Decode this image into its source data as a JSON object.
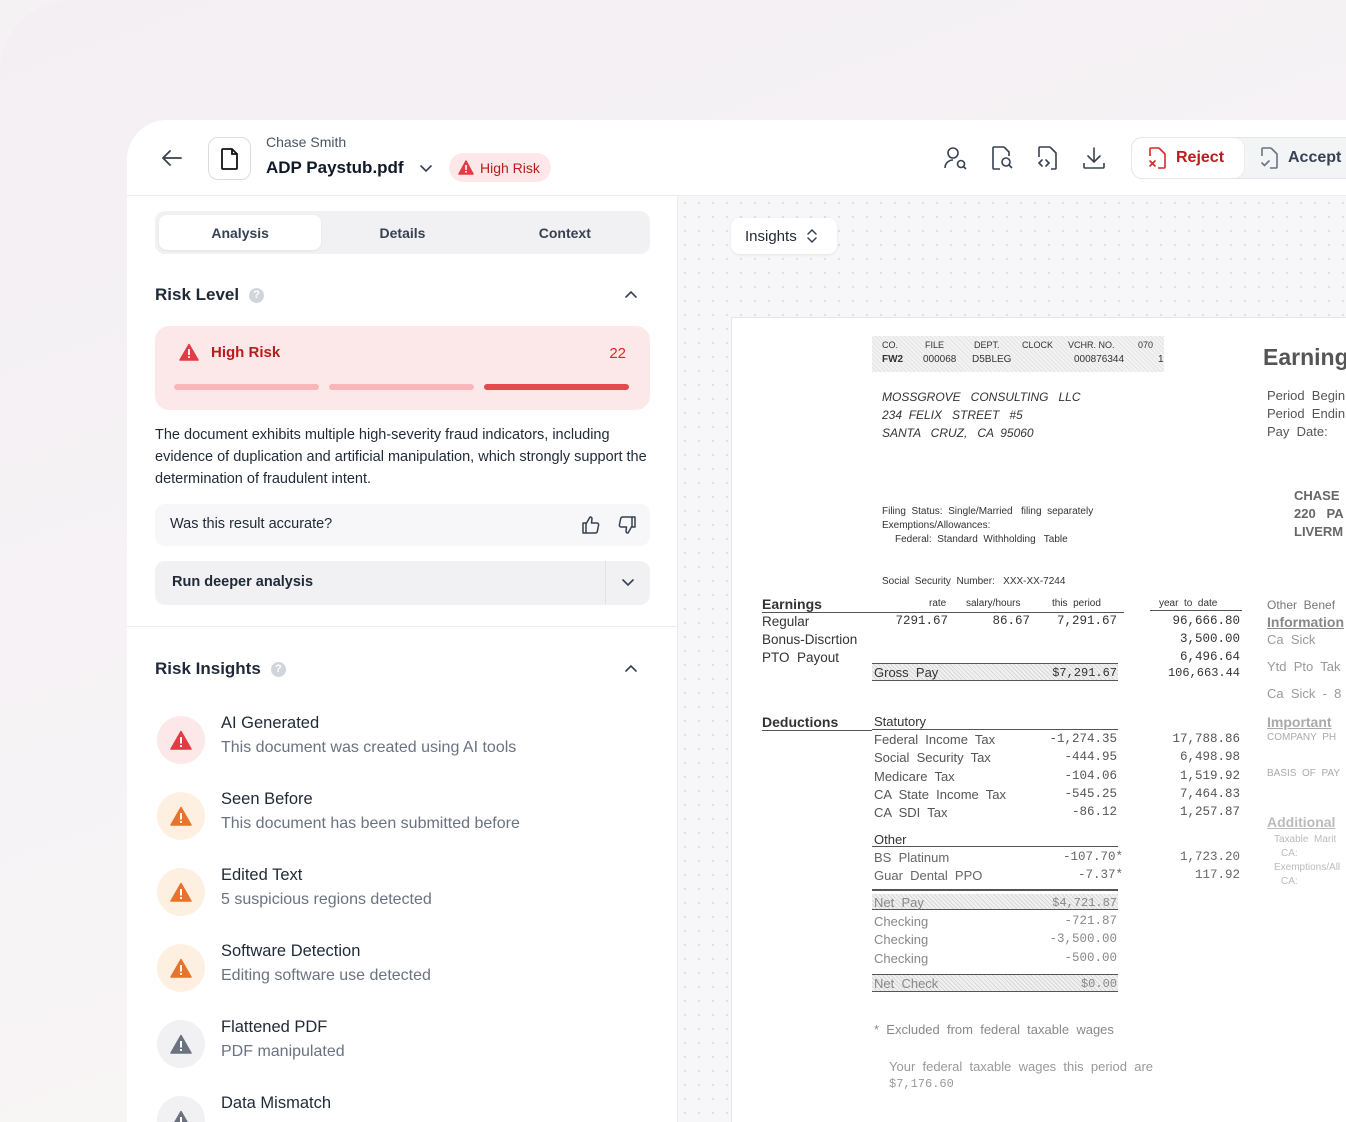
{
  "header": {
    "owner": "Chase Smith",
    "filename": "ADP Paystub.pdf",
    "risk_badge": "High Risk",
    "reject_label": "Reject",
    "accept_label": "Accept"
  },
  "tabs": [
    "Analysis",
    "Details",
    "Context"
  ],
  "risk_level": {
    "heading": "Risk Level",
    "label": "High Risk",
    "score": "22",
    "description": "The document exhibits multiple high-severity fraud indicators, including evidence of duplication and artificial manipulation, which strongly support the determination of fraudulent intent.",
    "feedback_question": "Was this result accurate?",
    "deeper_label": "Run deeper analysis"
  },
  "risk_insights": {
    "heading": "Risk Insights",
    "items": [
      {
        "title": "AI Generated",
        "subtitle": "This document was created using AI tools",
        "severity": "high"
      },
      {
        "title": "Seen Before",
        "subtitle": "This document has been submitted before",
        "severity": "medium"
      },
      {
        "title": "Edited Text",
        "subtitle": "5 suspicious regions detected",
        "severity": "medium"
      },
      {
        "title": "Software Detection",
        "subtitle": "Editing software use detected",
        "severity": "medium"
      },
      {
        "title": "Flattened PDF",
        "subtitle": "PDF manipulated",
        "severity": "low"
      },
      {
        "title": "Data Mismatch",
        "subtitle": "",
        "severity": "low"
      }
    ]
  },
  "viewer": {
    "dropdown_label": "Insights"
  },
  "colors": {
    "high": "#e03c45",
    "high_bg": "#fde8e9",
    "medium": "#e8732c",
    "medium_bg": "#fdf0e1",
    "low": "#6b7280",
    "low_bg": "#f1f1f3"
  },
  "paystub": {
    "hdr_labels": [
      "CO.",
      "FILE",
      "DEPT.",
      "CLOCK",
      "VCHR. NO.",
      "070"
    ],
    "hdr_values": [
      "FW2",
      "000068",
      "D5BLEG",
      "000876344",
      "1"
    ],
    "company": [
      "MOSSGROVE   CONSULTING   LLC",
      "234  FELIX   STREET   #5",
      "SANTA   CRUZ,   CA  95060"
    ],
    "filing": [
      "Filing  Status:  Single/Married   filing  separately",
      "Exemptions/Allowances:",
      "Federal:  Standard  Withholding   Table"
    ],
    "ssn": "Social  Security  Number:   XXX-XX-7244",
    "earnings_title": "Earnings",
    "col_rate": "rate",
    "col_hours": "salary/hours",
    "col_period": "this  period",
    "col_ytd": "year  to  date",
    "earn_rows": [
      {
        "label": "Regular",
        "rate": "7291.67",
        "hours": "86.67",
        "period": "7,291.67",
        "ytd": "96,666.80"
      },
      {
        "label": "Bonus-Discrtion",
        "rate": "",
        "hours": "",
        "period": "",
        "ytd": "3,500.00"
      },
      {
        "label": "PTO  Payout",
        "rate": "",
        "hours": "",
        "period": "",
        "ytd": "6,496.64"
      }
    ],
    "gross_label": "Gross  Pay",
    "gross_value": "$7,291.67",
    "gross_ytd": "106,663.44",
    "deductions_title": "Deductions",
    "statutory_title": "Statutory",
    "statutory_rows": [
      {
        "label": "Federal  Income  Tax",
        "period": "-1,274.35",
        "ytd": "17,788.86"
      },
      {
        "label": "Social  Security  Tax",
        "period": "-444.95",
        "ytd": "6,498.98"
      },
      {
        "label": "Medicare  Tax",
        "period": "-104.06",
        "ytd": "1,519.92"
      },
      {
        "label": "CA  State  Income  Tax",
        "period": "-545.25",
        "ytd": "7,464.83"
      },
      {
        "label": "CA  SDI  Tax",
        "period": "-86.12",
        "ytd": "1,257.87"
      }
    ],
    "other_title": "Other",
    "other_rows": [
      {
        "label": "BS  Platinum",
        "period": "-107.70*",
        "ytd": "1,723.20"
      },
      {
        "label": "Guar  Dental  PPO",
        "period": "-7.37*",
        "ytd": "117.92"
      }
    ],
    "net_pay_label": "Net  Pay",
    "net_pay_value": "$4,721.87",
    "checking_rows": [
      {
        "label": "Checking",
        "period": "-721.87"
      },
      {
        "label": "Checking",
        "period": "-3,500.00"
      },
      {
        "label": "Checking",
        "period": "-500.00"
      }
    ],
    "net_check_label": "Net  Check",
    "net_check_value": "$0.00",
    "footnote": "*  Excluded  from  federal  taxable  wages",
    "footnote2a": "Your  federal  taxable  wages  this  period  are",
    "footnote2b": "$7,176.60",
    "r_title": "Earning",
    "r_period": [
      "Period  Begin",
      "Period  Endin",
      "Pay  Date:"
    ],
    "r_addr": [
      "CHASE",
      "220   PA",
      "LIVERM"
    ],
    "r_other": "Other  Benef",
    "r_info": "Information",
    "r_rows": [
      "Ca  Sick",
      "Ytd  Pto  Tak",
      "Ca  Sick  -  8"
    ],
    "r_important": "Important",
    "r_company": "COMPANY  PH",
    "r_basis": "BASIS  OF  PAY",
    "r_additional": "Additional",
    "r_taxable": "Taxable  Marit",
    "r_ca1": "CA:",
    "r_exempt": "Exemptions/All",
    "r_ca2": "CA:"
  }
}
